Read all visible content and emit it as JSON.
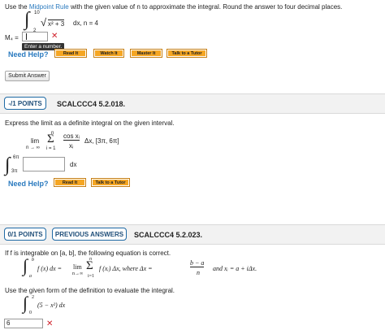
{
  "q1": {
    "instr_a": "Use the",
    "instr_link": "Midpoint Rule",
    "instr_b": "with the given value of n to approximate the integral. Round the answer to four decimal places.",
    "upper": "10",
    "lower": "2",
    "integrand": "x² + 3",
    "dx_n": "dx, n = 4",
    "m_label": "M₄ =",
    "m_value": "",
    "tooltip": "Enter a number.",
    "need_help": "Need Help?",
    "buttons": [
      "Read It",
      "Watch It",
      "Master It",
      "Talk to a Tutor"
    ],
    "submit": "Submit Answer"
  },
  "q2": {
    "points": "-/1 POINTS",
    "code": "SCALCCC4 5.2.018.",
    "instr": "Express the limit as a definite integral on the given interval.",
    "lim": "lim",
    "lim_sub": "n → ∞",
    "sum_top": "n",
    "sum_bottom": "i = 1",
    "frac_num": "cos xᵢ",
    "frac_den": "xᵢ",
    "interval": "Δx, [3π, 6π]",
    "int_upper": "6π",
    "int_lower": "3π",
    "answer_value": "",
    "dx": "dx",
    "need_help": "Need Help?",
    "buttons": [
      "Read It",
      "Talk to a Tutor"
    ]
  },
  "q3": {
    "points": "0/1 POINTS",
    "prev_answers": "PREVIOUS ANSWERS",
    "code": "SCALCCC4 5.2.023.",
    "intro": "If f is integrable on [a, b], the following equation is correct.",
    "eq_lhs": "f (x) dx =",
    "eq_lim": "lim",
    "eq_lim_sub": "n→∞",
    "eq_sum_top": "n",
    "eq_sum_bottom": "i=1",
    "eq_term": "f (xᵢ) Δx,  where Δx =",
    "eq_frac_num": "b − a",
    "eq_frac_den": "n",
    "eq_tail": "and  xᵢ = a + iΔx.",
    "eq_upper": "b",
    "eq_lower": "a",
    "use_form": "Use the given form of the definition to evaluate the integral.",
    "int_upper": "2",
    "int_lower": "0",
    "integrand": "(5 − x²) dx",
    "answer_value": "6"
  },
  "colors": {
    "link": "#2a7abf",
    "button": "#f5a623",
    "error": "#d0202a",
    "bar": "#f2f2f2"
  }
}
